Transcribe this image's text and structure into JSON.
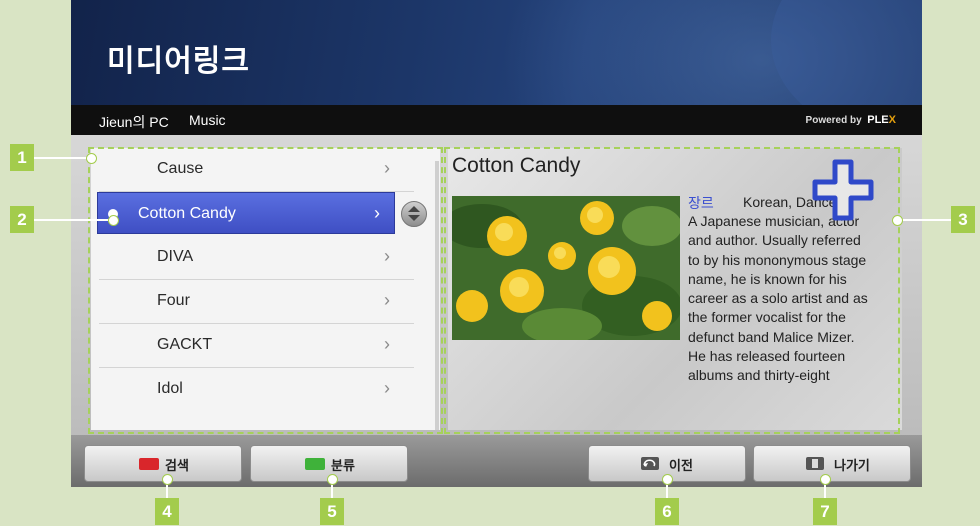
{
  "app": {
    "title": "미디어링크"
  },
  "breadcrumb": {
    "device": "Jieun의 PC",
    "section": "Music",
    "powered_by": "Powered by",
    "brand_pre": "PLE",
    "brand_x": "X"
  },
  "list": {
    "items": [
      {
        "label": "Cause",
        "chevron": "›"
      },
      {
        "label": "Cotton Candy",
        "chevron": "›",
        "selected": true
      },
      {
        "label": "DIVA",
        "chevron": "›"
      },
      {
        "label": "Four",
        "chevron": "›"
      },
      {
        "label": "GACKT",
        "chevron": "›"
      },
      {
        "label": "Idol",
        "chevron": "›"
      }
    ]
  },
  "detail": {
    "title": "Cotton Candy",
    "genre_label": "장르",
    "genre_value": "Korean, Dance",
    "bio_lines": [
      "A Japanese musician, actor",
      "and author. Usually referred",
      "to by his mononymous stage",
      "name, he is known for his",
      "career as a solo artist and as",
      "the former vocalist for the",
      "defunct band Malice Mizer.",
      "He has released fourteen",
      "albums and thirty-eight"
    ]
  },
  "buttons": {
    "search": {
      "label": "검색",
      "color": "#d9262b"
    },
    "category": {
      "label": "분류",
      "color": "#3fb23a"
    },
    "back": {
      "label": "이전",
      "icon": "back-icon"
    },
    "exit": {
      "label": "나가기",
      "icon": "exit-icon"
    }
  },
  "callouts": [
    "1",
    "2",
    "3",
    "4",
    "5",
    "6",
    "7"
  ],
  "colors": {
    "accent": "#a3cc4c",
    "selection": "#4a5ed6"
  }
}
